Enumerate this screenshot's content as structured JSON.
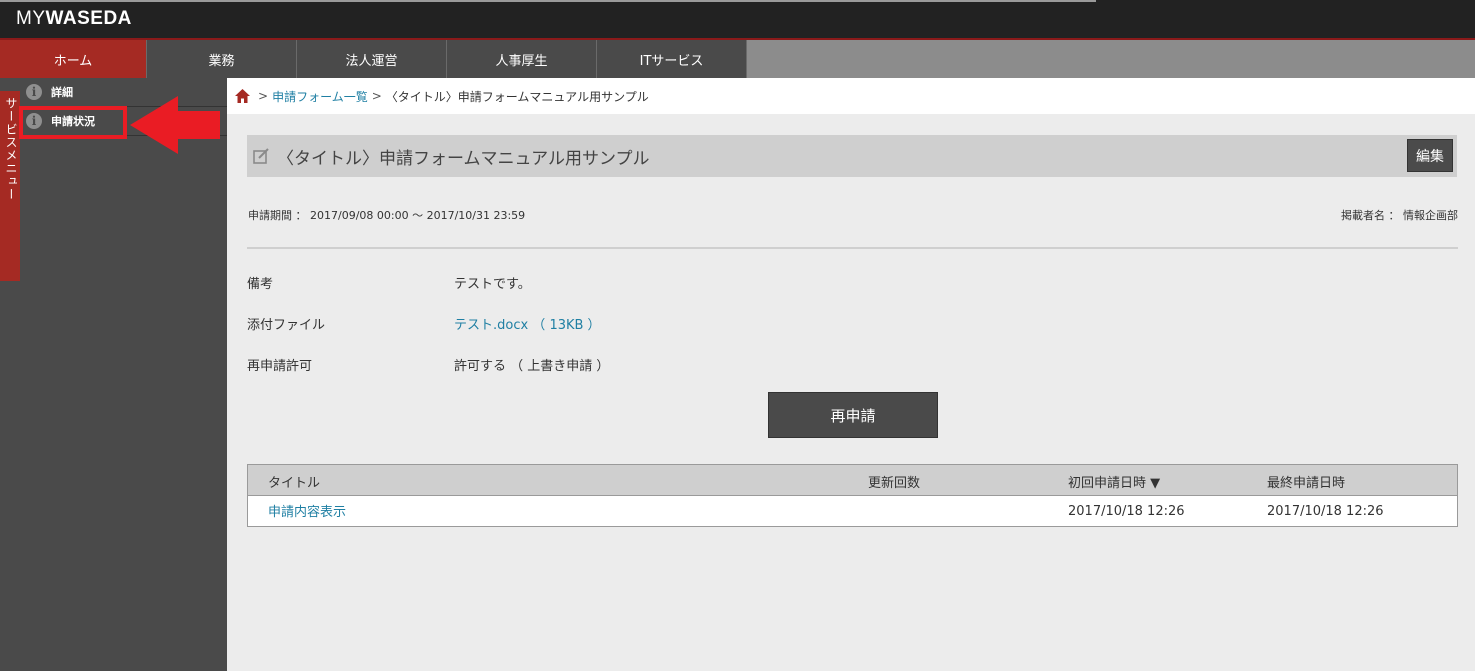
{
  "header": {
    "logo_my": "MY",
    "logo_waseda": "WASEDA"
  },
  "nav": {
    "tabs": [
      {
        "label": "ホーム"
      },
      {
        "label": "業務"
      },
      {
        "label": "法人運営"
      },
      {
        "label": "人事厚生"
      },
      {
        "label": "ITサービス"
      }
    ]
  },
  "sidebar": {
    "service_menu_label": "サービスメニュー",
    "items": [
      {
        "label": "詳細",
        "icon": "info-icon"
      },
      {
        "label": "申請状況",
        "icon": "info-icon"
      }
    ],
    "annotation_color": "#ea1c24"
  },
  "breadcrumb": {
    "link": "申請フォーム一覧",
    "separator": ">",
    "current": "〈タイトル〉申請フォームマニュアル用サンプル"
  },
  "form": {
    "title": "〈タイトル〉申請フォームマニュアル用サンプル",
    "edit_label": "編集",
    "period": "申請期間 ： 2017/09/08 00:00 〜 2017/10/31 23:59",
    "author": "掲載者名 ： 情報企画部",
    "fields": [
      {
        "label": "備考",
        "value": "テストです。"
      },
      {
        "label": "添付ファイル",
        "value": "テスト.docx （ 13KB ）"
      },
      {
        "label": "再申請許可",
        "value": "許可する （ 上書き申請 ）"
      }
    ],
    "reapply_label": "再申請"
  },
  "table": {
    "headers": [
      "タイトル",
      "更新回数",
      "初回申請日時 ▼",
      "最終申請日時"
    ],
    "rows": [
      {
        "title": "申請内容表示",
        "count": "",
        "first": "2017/10/18 12:26",
        "last": "2017/10/18 12:26"
      }
    ]
  },
  "colors": {
    "brand_red": "#a52a23",
    "link": "#1f7fa3",
    "header_bg": "#222222"
  }
}
